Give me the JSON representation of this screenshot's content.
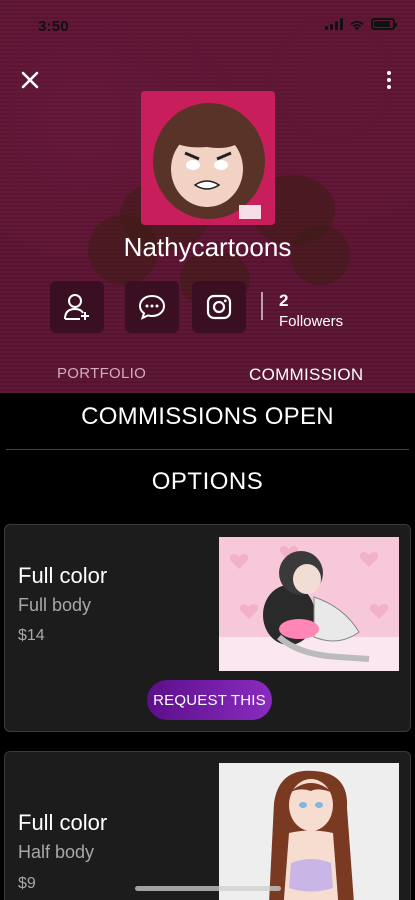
{
  "status_bar": {
    "time": "3:50"
  },
  "profile": {
    "name": "Nathycartoons",
    "followers_count": "2",
    "followers_label": "Followers"
  },
  "tabs": [
    {
      "label": "PORTFOLIO"
    },
    {
      "label": "COMMISSION"
    }
  ],
  "commissions": {
    "status": "COMMISSIONS OPEN",
    "options_title": "OPTIONS",
    "items": [
      {
        "title": "Full color",
        "subtitle": "Full body",
        "price": "$14",
        "button": "REQUEST THIS"
      },
      {
        "title": "Full color",
        "subtitle": "Half body",
        "price": "$9"
      }
    ]
  },
  "icons": {
    "close": "close-icon",
    "more": "more-vertical-icon",
    "follow": "add-user-icon",
    "message": "chat-bubble-icon",
    "instagram": "instagram-icon"
  },
  "colors": {
    "header_bg": "#5a1331",
    "button_bg": "#3a0f22",
    "accent": "#7a1fb0",
    "card_bg": "#1c1c1c"
  }
}
